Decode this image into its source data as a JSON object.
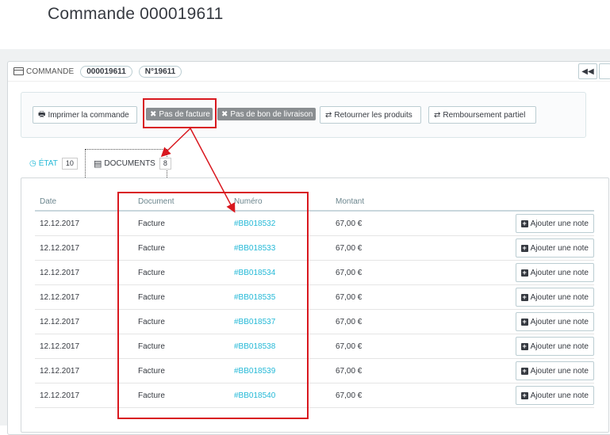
{
  "page": {
    "title": "Commande 000019611"
  },
  "panel": {
    "title": "COMMANDE",
    "reference": "000019611",
    "number": "N°19611",
    "nav_prev_icon": "double-chevron-left-icon"
  },
  "actions": {
    "print": {
      "label": "Imprimer la commande",
      "icon": "printer-icon"
    },
    "no_invoice": {
      "label": "Pas de facture",
      "icon": "close-icon"
    },
    "no_delivery": {
      "label": "Pas de bon de livraison",
      "icon": "close-icon"
    },
    "return": {
      "label": "Retourner les produits",
      "icon": "exchange-icon"
    },
    "refund": {
      "label": "Remboursement partiel",
      "icon": "exchange-icon"
    }
  },
  "tabs": [
    {
      "label": "ÉTAT",
      "count": "10",
      "icon": "clock-icon"
    },
    {
      "label": "DOCUMENTS",
      "count": "8",
      "icon": "file-icon"
    }
  ],
  "table": {
    "headers": [
      "Date",
      "Document",
      "Numéro",
      "Montant"
    ],
    "note_label": "Ajouter une note",
    "rows": [
      {
        "date": "12.12.2017",
        "document": "Facture",
        "number": "#BB018532",
        "amount": "67,00 €"
      },
      {
        "date": "12.12.2017",
        "document": "Facture",
        "number": "#BB018533",
        "amount": "67,00 €"
      },
      {
        "date": "12.12.2017",
        "document": "Facture",
        "number": "#BB018534",
        "amount": "67,00 €"
      },
      {
        "date": "12.12.2017",
        "document": "Facture",
        "number": "#BB018535",
        "amount": "67,00 €"
      },
      {
        "date": "12.12.2017",
        "document": "Facture",
        "number": "#BB018537",
        "amount": "67,00 €"
      },
      {
        "date": "12.12.2017",
        "document": "Facture",
        "number": "#BB018538",
        "amount": "67,00 €"
      },
      {
        "date": "12.12.2017",
        "document": "Facture",
        "number": "#BB018539",
        "amount": "67,00 €"
      },
      {
        "date": "12.12.2017",
        "document": "Facture",
        "number": "#BB018540",
        "amount": "67,00 €"
      }
    ]
  },
  "colors": {
    "accent": "#25b9d7",
    "annotation": "#d9181f",
    "dark_button": "#8a8e91"
  }
}
